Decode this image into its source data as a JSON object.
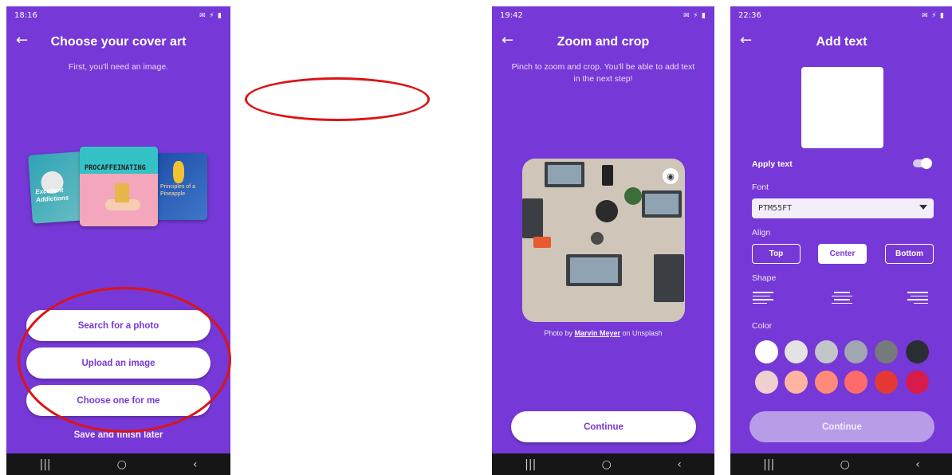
{
  "screen1": {
    "status_time": "18:16",
    "status_right": "✉ ⚡ ▮",
    "title": "Choose your cover art",
    "subtitle": "First, you'll need an image.",
    "card_left_text": "Excellent Addictions",
    "card_center_text": "PROCAFFEINATING",
    "card_right_text": "Principles of a Pineapple",
    "buttons": [
      "Search for a photo",
      "Upload an image",
      "Choose one for me"
    ],
    "save_later": "Save and finish later"
  },
  "screen2": {
    "status_time": "19:42",
    "status_right": "✉ ⚡ ▮",
    "title": "Zoom and crop",
    "subtitle": "Pinch to zoom and crop. You'll be able to add text in the next step!",
    "credit_prefix": "Photo by",
    "credit_author": "Marvin Meyer",
    "credit_suffix": "on Unsplash",
    "continue": "Continue"
  },
  "screen3": {
    "status_time": "22:36",
    "status_right": "✉ ⚡ ▮",
    "title": "Add text",
    "apply_text": "Apply text",
    "font_label": "Font",
    "font_value": "PTM55FT",
    "align_label": "Align",
    "align_options": [
      "Top",
      "Center",
      "Bottom"
    ],
    "align_selected": "Center",
    "shape_label": "Shape",
    "color_label": "Color",
    "colors_row1": [
      "#ffffff",
      "#e3e3e3",
      "#c3c6c9",
      "#a0a7b1",
      "#777a7d",
      "#2a2e33"
    ],
    "colors_row2": [
      "#f0cfd0",
      "#ffb4a2",
      "#ff8a7a",
      "#ff6b6b",
      "#e53935",
      "#d81b4a"
    ],
    "continue": "Continue"
  },
  "nav_icons": [
    "recents-icon",
    "home-icon",
    "back-icon"
  ],
  "nav_glyphs": [
    "|||",
    "○",
    "‹"
  ]
}
